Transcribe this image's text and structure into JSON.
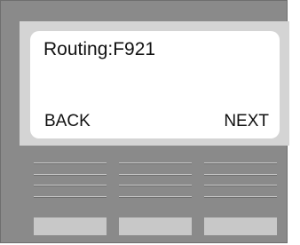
{
  "display": {
    "line1": "Routing:F921",
    "soft_left": "BACK",
    "soft_right": "NEXT"
  },
  "colors": {
    "body": "#8a8a8a",
    "bezel": "#d4d4d4",
    "screen": "#ffffff",
    "key": "#c8c8c8",
    "text": "#111111"
  }
}
